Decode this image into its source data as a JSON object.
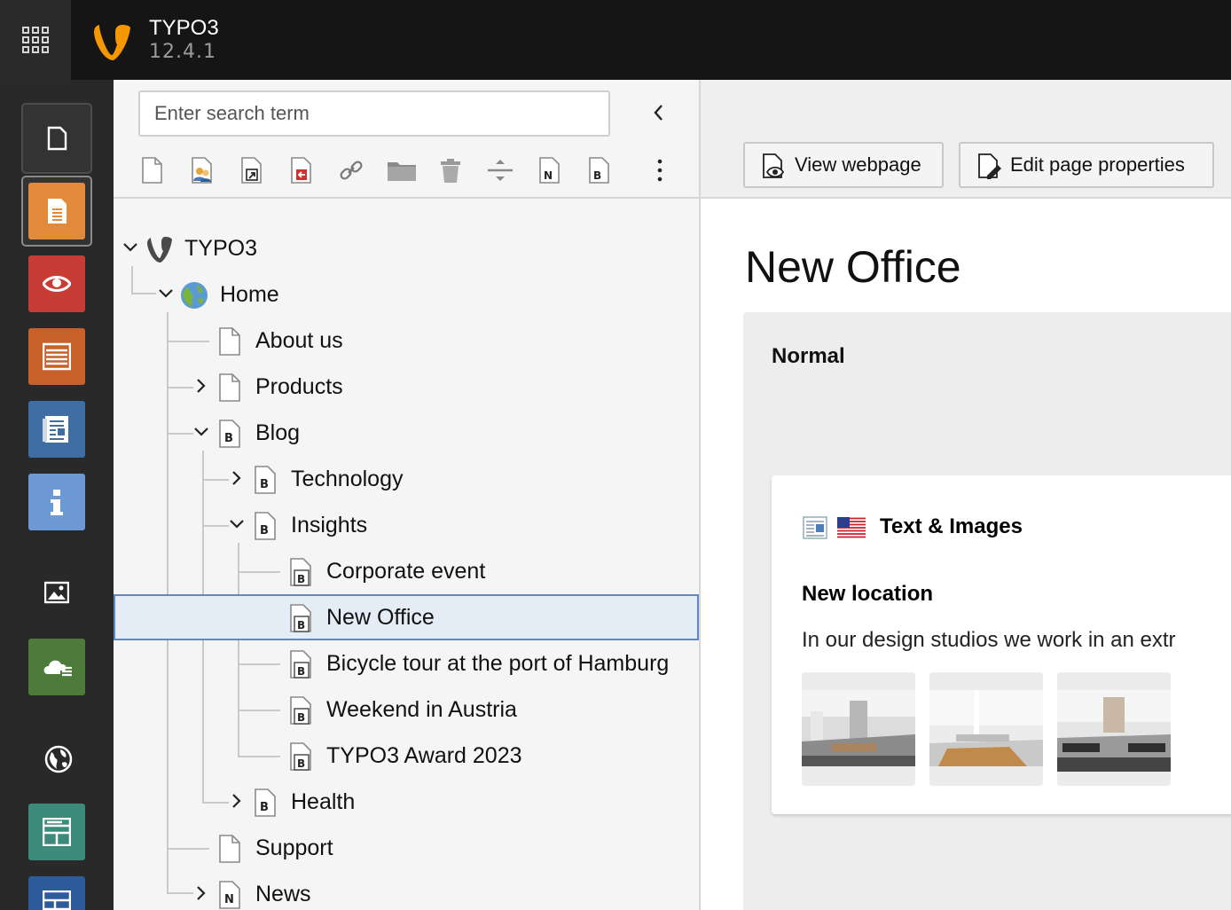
{
  "app": {
    "name": "TYPO3",
    "version": "12.4.1"
  },
  "topbar": {
    "apps_icon": "grid-icon",
    "logo_icon": "typo3-logo-icon"
  },
  "modules": [
    {
      "name": "page",
      "icon": "page-icon",
      "color": "#333333"
    },
    {
      "name": "page-layout",
      "icon": "document-lines-icon",
      "color": "#e08a3a"
    },
    {
      "name": "view",
      "icon": "eye-icon",
      "color": "#c83c36"
    },
    {
      "name": "list",
      "icon": "list-icon",
      "color": "#c8602a"
    },
    {
      "name": "news",
      "icon": "news-icon",
      "color": "#3f6ea5"
    },
    {
      "name": "info",
      "icon": "info-icon",
      "color": "#6c98d3"
    },
    {
      "name": "media",
      "icon": "image-icon",
      "color": "#292929"
    },
    {
      "name": "forms",
      "icon": "cloud-list-icon",
      "color": "#4d7c3a"
    },
    {
      "name": "sites",
      "icon": "globe-icon",
      "color": "#292929"
    },
    {
      "name": "templates",
      "icon": "layout-icon",
      "color": "#3c8a7a"
    },
    {
      "name": "layout",
      "icon": "layout-icon",
      "color": "#2c5a9a"
    }
  ],
  "tree": {
    "search_placeholder": "Enter search term",
    "collapse_icon": "chevron-left-icon",
    "toolbar": [
      "new-page-icon",
      "backend-user-icon",
      "shortcut-icon",
      "link-to-external-icon",
      "link-icon",
      "folder-icon",
      "recycler-icon",
      "spacer-icon",
      "news-folder-icon",
      "blog-page-icon",
      "more-icon"
    ],
    "root": "TYPO3",
    "nodes": [
      {
        "label": "Home",
        "icon": "globe-icon",
        "chevron": "down"
      },
      {
        "label": "About us",
        "icon": "page-icon",
        "chevron": ""
      },
      {
        "label": "Products",
        "icon": "page-icon",
        "chevron": "right"
      },
      {
        "label": "Blog",
        "icon": "blog-page-icon",
        "chevron": "down"
      },
      {
        "label": "Technology",
        "icon": "blog-page-icon",
        "chevron": "right"
      },
      {
        "label": "Insights",
        "icon": "blog-page-icon",
        "chevron": "down"
      },
      {
        "label": "Corporate event",
        "icon": "blog-post-icon",
        "chevron": ""
      },
      {
        "label": "New Office",
        "icon": "blog-post-icon",
        "chevron": "",
        "selected": true
      },
      {
        "label": "Bicycle tour at the port of Hamburg",
        "icon": "blog-post-icon",
        "chevron": ""
      },
      {
        "label": "Weekend in Austria",
        "icon": "blog-post-icon",
        "chevron": ""
      },
      {
        "label": "TYPO3 Award 2023",
        "icon": "blog-post-icon",
        "chevron": ""
      },
      {
        "label": "Health",
        "icon": "blog-page-icon",
        "chevron": "right"
      },
      {
        "label": "Support",
        "icon": "page-icon",
        "chevron": ""
      },
      {
        "label": "News",
        "icon": "news-page-icon",
        "chevron": "right"
      }
    ]
  },
  "header": {
    "view_webpage": "View webpage",
    "edit_page_properties": "Edit page properties"
  },
  "content": {
    "page_title": "New Office",
    "column_title": "Normal",
    "element": {
      "type_label": "Text & Images",
      "header": "New location",
      "bodytext": "In our design studios we work in an extr",
      "flag_icon": "us-flag-icon",
      "type_icon": "textpic-icon"
    }
  }
}
